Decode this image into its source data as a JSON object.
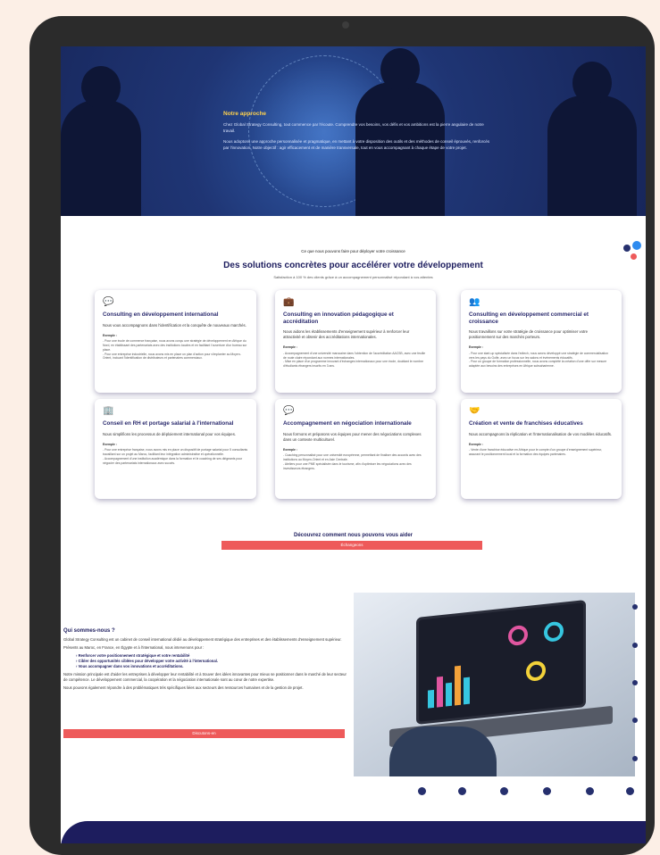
{
  "hero": {
    "title": "Notre approche",
    "p1": "Chez Global Strategy Consulting, tout commence par l'écoute. Comprendre vos besoins, vos défis et vos ambitions est la pierre angulaire de notre travail.",
    "p2": "Nous adoptons une approche personnalisée et pragmatique, en mettant à votre disposition des outils et des méthodes de conseil éprouvés, renforcés par l'innovation. Notre objectif : agir efficacement et de manière transversale, tout en vous accompagnant à chaque étape de votre projet."
  },
  "solutions": {
    "pretitle": "Ce que nous pouvons faire pour déployer votre croissance",
    "title": "Des solutions concrètes pour accélérer votre développement",
    "subtitle": "Satisfaction à 100 % des clients grâce à un accompagnement personnalisé répondant à vos attentes",
    "cards": [
      {
        "icon": "💬",
        "title": "Consulting en développement international",
        "desc": "Nous vous accompagnons dans l'identification et la conquête de nouveaux marchés.",
        "example_label": "Exemple :",
        "ex1": "- Pour une école de commerce française, nous avons conçu une stratégie de développement en Afrique du Nord, en établissant des partenariats avec des institutions locales et en facilitant l'ouverture d'un bureau sur place.",
        "ex2": "- Pour une entreprise industrielle, nous avons mis en place un plan d'action pour s'implanter au Moyen-Orient, incluant l'identification de distributeurs et partenaires commerciaux."
      },
      {
        "icon": "💼",
        "title": "Consulting en innovation pédagogique et accréditation",
        "desc": "Nous aidons les établissements d'enseignement supérieur à renforcer leur attractivité et obtenir des accréditations internationales.",
        "example_label": "Exemple :",
        "ex1": "- Accompagnement d'une université marocaine dans l'obtention de l'accréditation AACSB, avec une feuille de route claire répondant aux normes internationales.",
        "ex2": "- Mise en place d'un programme innovant d'échanges internationaux pour une école, doublant le nombre d'étudiants étrangers inscrits en 3 ans."
      },
      {
        "icon": "👥",
        "title": "Consulting en développement commercial et croissance",
        "desc": "Nous travaillons sur votre stratégie de croissance pour optimiser votre positionnement sur des marchés porteurs.",
        "example_label": "Exemple :",
        "ex1": "- Pour une start-up spécialisée dans l'edtech, nous avons développé une stratégie de commercialisation vers les pays du Golfe, avec un focus sur les salons et événements éducatifs.",
        "ex2": "- Pour un groupe de formation professionnelle, nous avons complété la création d'une offre sur mesure adaptée aux besoins des entreprises en Afrique subsaharienne."
      },
      {
        "icon": "🏢",
        "title": "Conseil en RH et portage salarial à l'international",
        "desc": "Nous simplifions les processus de déploiement international pour vos équipes.",
        "example_label": "Exemple :",
        "ex1": "- Pour une entreprise française, nous avons mis en place un dispositif de portage salarial pour 5 consultants travaillant sur un projet au Maroc, facilitant leur intégration administrative et opérationnelle.",
        "ex2": "- Accompagnement d'une institution académique dans la formation et le coaching de ses dirigeants pour négocier des partenariats internationaux avec succès."
      },
      {
        "icon": "💬",
        "title": "Accompagnement en négociation internationale",
        "desc": "Nous formons et préparons vos équipes pour mener des négociations complexes dans un contexte multiculturel.",
        "example_label": "Exemple :",
        "ex1": "- Coaching personnalisé pour une université européenne, permettant de finaliser des accords avec des institutions au Moyen-Orient et en Asie Centrale.",
        "ex2": "- Ateliers pour une PME spécialisée dans le tourisme, afin d'optimiser les négociations avec des investisseurs étrangers."
      },
      {
        "icon": "🤝",
        "title": "Création et vente de franchises éducatives",
        "desc": "Nous accompagnons la réplication et l'internationalisation de vos modèles éducatifs.",
        "example_label": "Exemple :",
        "ex1": "- Vente d'une franchise éducative en Afrique pour le compte d'un groupe d'enseignement supérieur, assurant le positionnement local et la formation des équipes partenaires.",
        "ex2": ""
      }
    ]
  },
  "discover": {
    "title": "Découvrez comment nous pouvons vous aider",
    "button": "Échangeons"
  },
  "about": {
    "title": "Qui sommes-nous ?",
    "p1": "Global Strategy Consulting est un cabinet de conseil international dédié au développement stratégique des entreprises et des établissements d'enseignement supérieur.",
    "p2": "Présents au Maroc, en France, en Égypte et à l'international, nous intervenons pour :",
    "bullets": [
      "Renforcer votre positionnement stratégique et votre rentabilité",
      "Cibler des opportunités ciblées pour développer votre activité à l'international.",
      "Vous accompagner dans vos innovations et accréditations."
    ],
    "p3": "Notre mission principale est d'aider les entreprises à développer leur rentabilité et à trouver des idées innovantes pour mieux se positionner dans le marché de leur secteur de compétence. Le développement commercial, la coopération et la négociation internationale sont au cœur de notre expertise.",
    "p4": "Nous pouvons également répondre à des problématiques très spécifiques liées aux secteurs des ressources humaines et de la gestion de projet.",
    "button": "Discutons-en"
  },
  "colors": {
    "navy": "#1d1d5e",
    "accent": "#ee5a5a",
    "hero": "#1f3574"
  }
}
